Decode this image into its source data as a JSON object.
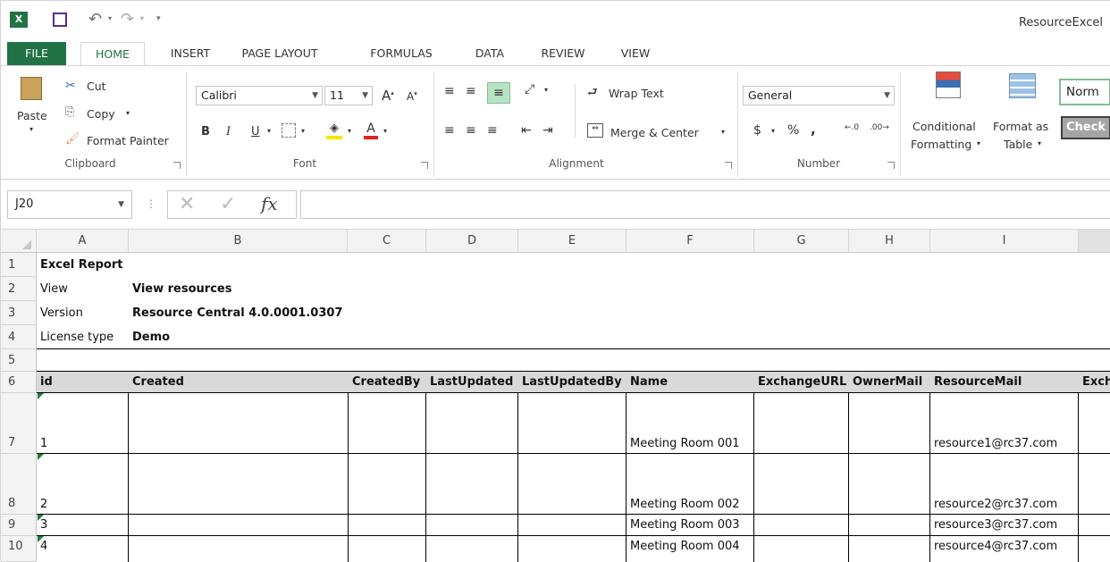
{
  "app": {
    "title": "ResourceExcel",
    "tabs": [
      "FILE",
      "HOME",
      "INSERT",
      "PAGE LAYOUT",
      "FORMULAS",
      "DATA",
      "REVIEW",
      "VIEW"
    ]
  },
  "ribbon": {
    "clipboard": {
      "paste": "Paste",
      "cut": "Cut",
      "copy": "Copy",
      "format_painter": "Format Painter",
      "label": "Clipboard"
    },
    "font": {
      "name": "Calibri",
      "size": "11",
      "label": "Font"
    },
    "alignment": {
      "wrap": "Wrap Text",
      "merge": "Merge & Center",
      "label": "Alignment"
    },
    "number": {
      "format": "General",
      "label": "Number"
    },
    "styles": {
      "conditional": "Conditional",
      "conditional2": "Formatting",
      "format_as": "Format as",
      "format_as2": "Table",
      "normal": "Norm",
      "check": "Check"
    }
  },
  "formula_bar": {
    "name_box": "J20",
    "fx": "fx",
    "value": ""
  },
  "columns": [
    "A",
    "B",
    "C",
    "D",
    "E",
    "F",
    "G",
    "H",
    "I"
  ],
  "rows": [
    "1",
    "2",
    "3",
    "4",
    "5",
    "6",
    "7",
    "8",
    "9",
    "10"
  ],
  "cells": {
    "a1": "Excel Report",
    "a2": "View",
    "b2": "View resources",
    "a3": "Version",
    "b3": "Resource Central 4.0.0001.0307",
    "a4": "License type",
    "b4": "Demo",
    "headers": [
      "id",
      "Created",
      "CreatedBy",
      "LastUpdated",
      "LastUpdatedBy",
      "Name",
      "ExchangeURL",
      "OwnerMail",
      "ResourceMail",
      "Exch"
    ],
    "data": [
      {
        "id": "1",
        "name": "Meeting Room 001",
        "mail": "resource1@rc37.com"
      },
      {
        "id": "2",
        "name": "Meeting Room 002",
        "mail": "resource2@rc37.com"
      },
      {
        "id": "3",
        "name": "Meeting Room 003",
        "mail": "resource3@rc37.com"
      },
      {
        "id": "4",
        "name": "Meeting Room 004",
        "mail": "resource4@rc37.com"
      }
    ]
  },
  "colors": {
    "excel_green": "#217346",
    "header_bg": "#f3f3f3",
    "accent": "#1e7b3a"
  }
}
